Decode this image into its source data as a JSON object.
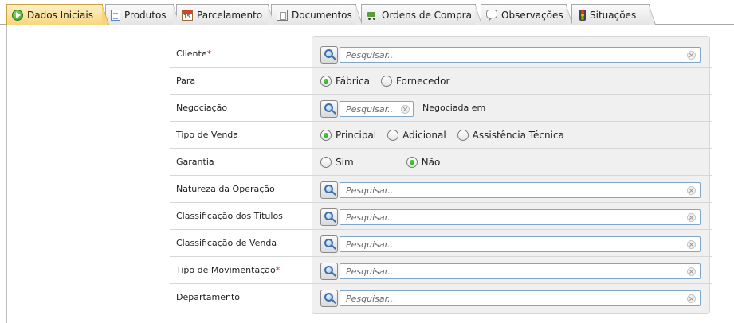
{
  "tabs": [
    {
      "label": "Dados Iniciais",
      "icon": "play-circle-icon",
      "active": true
    },
    {
      "label": "Produtos",
      "icon": "document-icon",
      "active": false
    },
    {
      "label": "Parcelamento",
      "icon": "calendar-icon",
      "active": false
    },
    {
      "label": "Documentos",
      "icon": "documents-icon",
      "active": false
    },
    {
      "label": "Ordens de Compra",
      "icon": "shopping-cart-icon",
      "active": false
    },
    {
      "label": "Observações",
      "icon": "chat-bubble-icon",
      "active": false
    },
    {
      "label": "Situações",
      "icon": "traffic-light-icon",
      "active": false
    }
  ],
  "form": {
    "cliente": {
      "label": "Cliente",
      "required_mark": "*",
      "placeholder": "Pesquisar...",
      "value": ""
    },
    "para": {
      "label": "Para",
      "options": [
        "Fábrica",
        "Fornecedor"
      ],
      "selected": "Fábrica"
    },
    "negociacao": {
      "label": "Negociação",
      "placeholder": "Pesquisar...",
      "value": "",
      "aside_label": "Negociada em"
    },
    "tipo_venda": {
      "label": "Tipo de Venda",
      "options": [
        "Principal",
        "Adicional",
        "Assistência Técnica"
      ],
      "selected": "Principal"
    },
    "garantia": {
      "label": "Garantia",
      "options": [
        "Sim",
        "Não"
      ],
      "selected": "Não"
    },
    "natureza_operacao": {
      "label": "Natureza da Operação",
      "placeholder": "Pesquisar...",
      "value": ""
    },
    "classificacao_titulos": {
      "label": "Classificação dos Titulos",
      "placeholder": "Pesquisar...",
      "value": ""
    },
    "classificacao_venda": {
      "label": "Classificação de Venda",
      "placeholder": "Pesquisar...",
      "value": ""
    },
    "tipo_movimentacao": {
      "label": "Tipo de Movimentação",
      "required_mark": "*",
      "placeholder": "Pesquisar...",
      "value": ""
    },
    "departamento": {
      "label": "Departamento",
      "placeholder": "Pesquisar...",
      "value": ""
    }
  },
  "colors": {
    "active_tab": "#f8d57a",
    "panel_bg": "#f0f0f0",
    "required": "#e02020",
    "radio_checked": "#169b0b",
    "input_border": "#7fa6c7"
  }
}
